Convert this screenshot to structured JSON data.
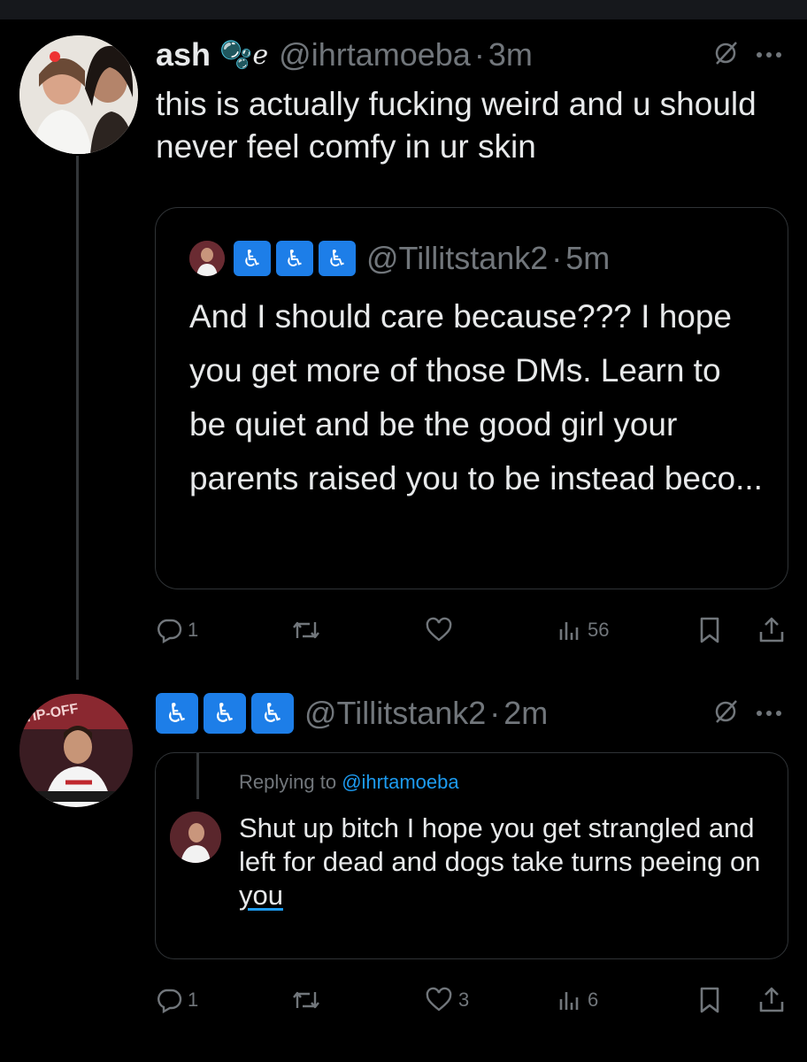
{
  "post1": {
    "display_name": "ash",
    "name_emoji": "🫧ℯ",
    "handle": "@ihrtamoeba",
    "separator": "·",
    "time": "3m",
    "text": "this is actually fucking weird and u should never feel comfy in ur skin",
    "quote": {
      "handle": "@Tillitstank2",
      "separator": "·",
      "time": "5m",
      "text": "And I should care because??? I hope you get more of those DMs. Learn to be quiet and be the good girl your parents raised you to be instead beco..."
    },
    "actions": {
      "replies": "1",
      "reposts": "",
      "likes": "",
      "views": "56"
    }
  },
  "post2": {
    "handle": "@Tillitstank2",
    "separator": "·",
    "time": "2m",
    "reply_card": {
      "replying_prefix": "Replying to",
      "replying_to": "@ihrtamoeba",
      "text_main": "Shut up bitch I hope you get strangled and left for dead and dogs take turns peeing on ",
      "text_end": "you"
    },
    "actions": {
      "replies": "1",
      "reposts": "",
      "likes": "3",
      "views": "6"
    }
  },
  "icons": {
    "wheelchair": "♿",
    "grok": "grok-icon",
    "more": "more-icon",
    "reply": "reply-icon",
    "repost": "repost-icon",
    "like": "heart-icon",
    "views": "views-icon",
    "bookmark": "bookmark-icon",
    "share": "share-icon"
  },
  "colors": {
    "background": "#000000",
    "text": "#e7e9ea",
    "muted": "#71767b",
    "border": "#2f3336",
    "accent": "#1d9bf0",
    "wheelchair_bg": "#1d7ee8"
  }
}
